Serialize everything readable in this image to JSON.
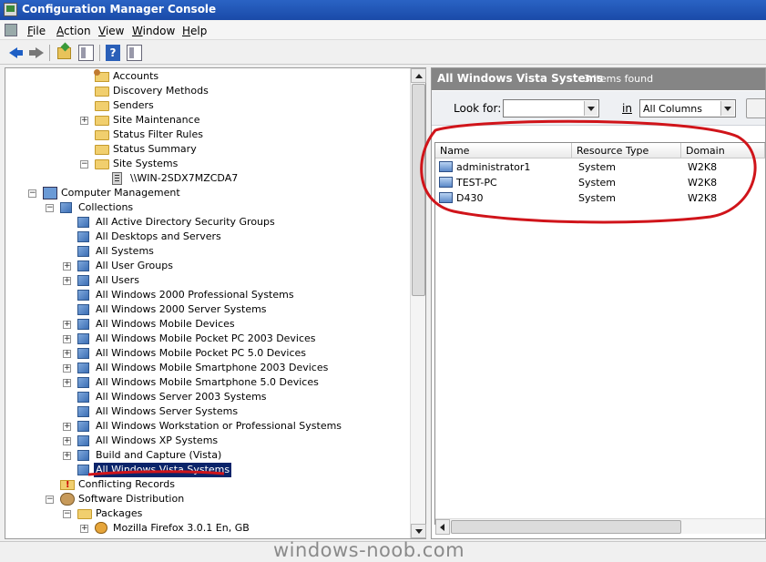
{
  "window": {
    "title": "Configuration Manager Console"
  },
  "menu": [
    {
      "label": "File",
      "underline": "F",
      "rest": "ile"
    },
    {
      "label": "Action",
      "underline": "A",
      "rest": "ction"
    },
    {
      "label": "View",
      "underline": "V",
      "rest": "iew"
    },
    {
      "label": "Window",
      "underline": "W",
      "rest": "indow"
    },
    {
      "label": "Help",
      "underline": "H",
      "rest": "elp"
    }
  ],
  "toolbar": {
    "buttons": [
      "back-icon",
      "forward-icon",
      "up-folder-icon",
      "show-hide-tree-icon",
      "help-icon",
      "properties-icon"
    ]
  },
  "tree": [
    {
      "label": "Accounts",
      "icon": "accounts-icon",
      "expander": ""
    },
    {
      "label": "Discovery Methods",
      "icon": "folder-icon",
      "expander": ""
    },
    {
      "label": "Senders",
      "icon": "folder-icon",
      "expander": ""
    },
    {
      "label": "Site Maintenance",
      "icon": "folder-icon",
      "expander": "+"
    },
    {
      "label": "Status Filter Rules",
      "icon": "folder-icon",
      "expander": ""
    },
    {
      "label": "Status Summary",
      "icon": "folder-icon",
      "expander": ""
    },
    {
      "label": "Site Systems",
      "icon": "folder-icon",
      "expander": "−"
    },
    {
      "label": "\\\\WIN-2SDX7MZCDA7",
      "icon": "server-icon",
      "expander": ""
    },
    {
      "label": "Computer Management",
      "icon": "computer-management-icon",
      "expander": "−"
    },
    {
      "label": "Collections",
      "icon": "collection-icon",
      "expander": "−"
    },
    {
      "label": "All Active Directory Security Groups",
      "icon": "collection-icon",
      "expander": ""
    },
    {
      "label": "All Desktops and Servers",
      "icon": "collection-icon",
      "expander": ""
    },
    {
      "label": "All Systems",
      "icon": "collection-icon",
      "expander": ""
    },
    {
      "label": "All User Groups",
      "icon": "collection-icon",
      "expander": "+"
    },
    {
      "label": "All Users",
      "icon": "collection-icon",
      "expander": "+"
    },
    {
      "label": "All Windows 2000 Professional Systems",
      "icon": "collection-icon",
      "expander": ""
    },
    {
      "label": "All Windows 2000 Server Systems",
      "icon": "collection-icon",
      "expander": ""
    },
    {
      "label": "All Windows Mobile Devices",
      "icon": "collection-icon",
      "expander": "+"
    },
    {
      "label": "All Windows Mobile Pocket PC 2003 Devices",
      "icon": "collection-icon",
      "expander": "+"
    },
    {
      "label": "All Windows Mobile Pocket PC 5.0 Devices",
      "icon": "collection-icon",
      "expander": "+"
    },
    {
      "label": "All Windows Mobile Smartphone 2003 Devices",
      "icon": "collection-icon",
      "expander": "+"
    },
    {
      "label": "All Windows Mobile Smartphone 5.0 Devices",
      "icon": "collection-icon",
      "expander": "+"
    },
    {
      "label": "All Windows Server 2003 Systems",
      "icon": "collection-icon",
      "expander": ""
    },
    {
      "label": "All Windows Server Systems",
      "icon": "collection-icon",
      "expander": ""
    },
    {
      "label": "All Windows Workstation or Professional Systems",
      "icon": "collection-icon",
      "expander": "+"
    },
    {
      "label": "All Windows XP Systems",
      "icon": "collection-icon",
      "expander": "+"
    },
    {
      "label": "Build and Capture (Vista)",
      "icon": "collection-icon",
      "expander": "+"
    },
    {
      "label": "All Windows Vista Systems",
      "icon": "collection-icon",
      "expander": "",
      "selected": true
    },
    {
      "label": "Conflicting Records",
      "icon": "conflicting-records-icon",
      "expander": ""
    },
    {
      "label": "Software Distribution",
      "icon": "software-distribution-icon",
      "expander": "−"
    },
    {
      "label": "Packages",
      "icon": "folder-icon",
      "expander": "−"
    },
    {
      "label": "Mozilla Firefox 3.0.1 En, GB",
      "icon": "package-icon",
      "expander": "+"
    }
  ],
  "results": {
    "title": "All Windows Vista Systems",
    "count": "3 items found",
    "find": {
      "look_for_label": "Look for:",
      "look_for_value": "",
      "in_label": "in",
      "in_value": "All Columns"
    },
    "columns": [
      "Name",
      "Resource Type",
      "Domain"
    ],
    "rows": [
      {
        "name": "administrator1",
        "type": "System",
        "domain": "W2K8"
      },
      {
        "name": "TEST-PC",
        "type": "System",
        "domain": "W2K8"
      },
      {
        "name": "D430",
        "type": "System",
        "domain": "W2K8"
      }
    ]
  },
  "annotation_color": "#d0141a",
  "selection_color": "#0a246a",
  "watermark": "windows-noob.com"
}
